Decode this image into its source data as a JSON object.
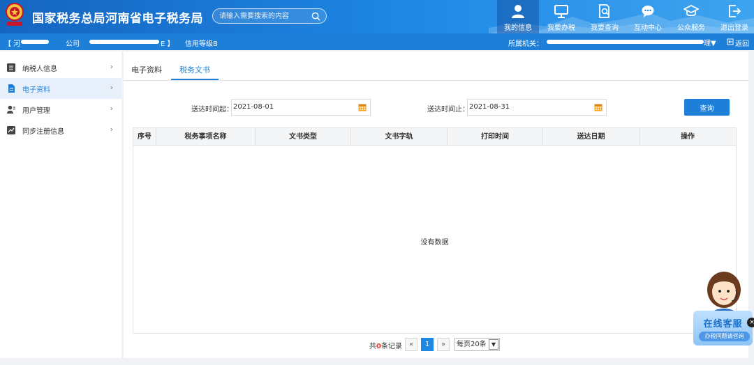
{
  "header": {
    "title": "国家税务总局河南省电子税务局",
    "search_placeholder": "请输入需要搜索的内容",
    "nav": [
      {
        "label": "我的信息",
        "icon": "user-icon"
      },
      {
        "label": "我要办税",
        "icon": "monitor-icon"
      },
      {
        "label": "我要查询",
        "icon": "document-search-icon"
      },
      {
        "label": "互动中心",
        "icon": "chat-bubble-icon"
      },
      {
        "label": "公众服务",
        "icon": "graduation-cap-icon"
      },
      {
        "label": "退出登录",
        "icon": "logout-icon"
      }
    ]
  },
  "subbar": {
    "company_prefix": "【 河",
    "company_mid": "公司",
    "company_suffix": "E 】",
    "credit": "信用等级B",
    "authority_label": "所属机关：",
    "authority_suffix": "理▼",
    "back_label": "返回"
  },
  "sidebar": {
    "items": [
      {
        "label": "纳税人信息",
        "icon": "list-icon",
        "active": false
      },
      {
        "label": "电子资料",
        "icon": "file-icon",
        "active": true
      },
      {
        "label": "用户管理",
        "icon": "user-manage-icon",
        "active": false
      },
      {
        "label": "同步注册信息",
        "icon": "chart-icon",
        "active": false
      }
    ],
    "arrow": "›"
  },
  "main": {
    "tabs": [
      {
        "label": "电子资料",
        "active": false
      },
      {
        "label": "税务文书",
        "active": true
      }
    ],
    "filter": {
      "start_label": "送达时间起：",
      "start_value": "2021-08-01",
      "end_label": "送达时间止：",
      "end_value": "2021-08-31",
      "query_label": "查询"
    },
    "table": {
      "columns": [
        "序号",
        "税务事项名称",
        "文书类型",
        "文书字轨",
        "打印时间",
        "送达日期",
        "操作"
      ],
      "empty_text": "没有数据"
    },
    "pager": {
      "total_prefix": "共",
      "total_count": "0",
      "total_suffix": "条记录",
      "prev": "«",
      "current": "1",
      "next": "»",
      "page_size": "每页20条"
    }
  },
  "cs_widget": {
    "title": "在线客服",
    "subtitle": "办税问题请咨询",
    "close": "×"
  },
  "colors": {
    "primary": "#1e7fd8",
    "header_start": "#1565c0",
    "accent_red": "#e53935"
  }
}
